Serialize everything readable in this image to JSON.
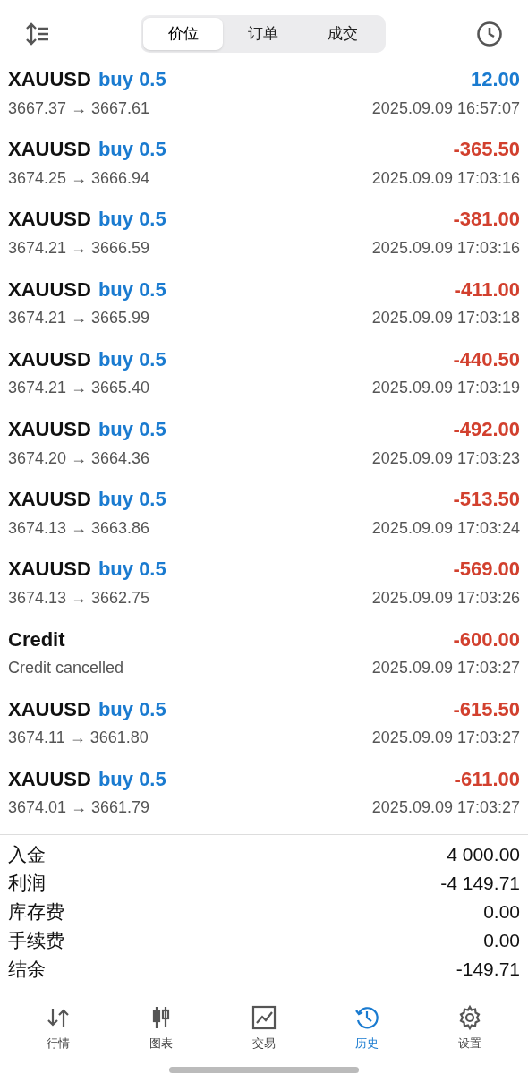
{
  "tabs": [
    {
      "label": "价位",
      "selected": true
    },
    {
      "label": "订单",
      "selected": false
    },
    {
      "label": "成交",
      "selected": false
    }
  ],
  "deals": [
    {
      "kind": "trade",
      "symbol": "XAUUSD",
      "side": "buy 0.5",
      "prices": "3667.37 → 3667.61",
      "time": "2025.09.09 16:57:07",
      "profit": "12.00",
      "color": "#1a7bd0"
    },
    {
      "kind": "trade",
      "symbol": "XAUUSD",
      "side": "buy 0.5",
      "prices": "3674.25 → 3666.94",
      "time": "2025.09.09 17:03:16",
      "profit": "-365.50",
      "color": "#d2402e"
    },
    {
      "kind": "trade",
      "symbol": "XAUUSD",
      "side": "buy 0.5",
      "prices": "3674.21 → 3666.59",
      "time": "2025.09.09 17:03:16",
      "profit": "-381.00",
      "color": "#d2402e"
    },
    {
      "kind": "trade",
      "symbol": "XAUUSD",
      "side": "buy 0.5",
      "prices": "3674.21 → 3665.99",
      "time": "2025.09.09 17:03:18",
      "profit": "-411.00",
      "color": "#d2402e"
    },
    {
      "kind": "trade",
      "symbol": "XAUUSD",
      "side": "buy 0.5",
      "prices": "3674.21 → 3665.40",
      "time": "2025.09.09 17:03:19",
      "profit": "-440.50",
      "color": "#d2402e"
    },
    {
      "kind": "trade",
      "symbol": "XAUUSD",
      "side": "buy 0.5",
      "prices": "3674.20 → 3664.36",
      "time": "2025.09.09 17:03:23",
      "profit": "-492.00",
      "color": "#d2402e"
    },
    {
      "kind": "trade",
      "symbol": "XAUUSD",
      "side": "buy 0.5",
      "prices": "3674.13 → 3663.86",
      "time": "2025.09.09 17:03:24",
      "profit": "-513.50",
      "color": "#d2402e"
    },
    {
      "kind": "trade",
      "symbol": "XAUUSD",
      "side": "buy 0.5",
      "prices": "3674.13 → 3662.75",
      "time": "2025.09.09 17:03:26",
      "profit": "-569.00",
      "color": "#d2402e"
    },
    {
      "kind": "credit",
      "symbol": "Credit",
      "prices": "Credit cancelled",
      "time": "2025.09.09 17:03:27",
      "profit": "-600.00",
      "color": "#d2402e"
    },
    {
      "kind": "trade",
      "symbol": "XAUUSD",
      "side": "buy 0.5",
      "prices": "3674.11 → 3661.80",
      "time": "2025.09.09 17:03:27",
      "profit": "-615.50",
      "color": "#d2402e"
    },
    {
      "kind": "trade",
      "symbol": "XAUUSD",
      "side": "buy 0.5",
      "prices": "3674.01 → 3661.79",
      "time": "2025.09.09 17:03:27",
      "profit": "-611.00",
      "color": "#d2402e"
    }
  ],
  "summary": [
    {
      "label": "入金",
      "value": "4 000.00"
    },
    {
      "label": "利润",
      "value": "-4 149.71"
    },
    {
      "label": "库存费",
      "value": "0.00"
    },
    {
      "label": "手续费",
      "value": "0.00"
    },
    {
      "label": "结余",
      "value": "-149.71"
    }
  ],
  "nav": [
    {
      "kind": "quotes",
      "label": "行情",
      "selected": false
    },
    {
      "kind": "chart",
      "label": "图表",
      "selected": false
    },
    {
      "kind": "trade",
      "label": "交易",
      "selected": false
    },
    {
      "kind": "history",
      "label": "历史",
      "selected": true
    },
    {
      "kind": "settings",
      "label": "设置",
      "selected": false
    }
  ]
}
